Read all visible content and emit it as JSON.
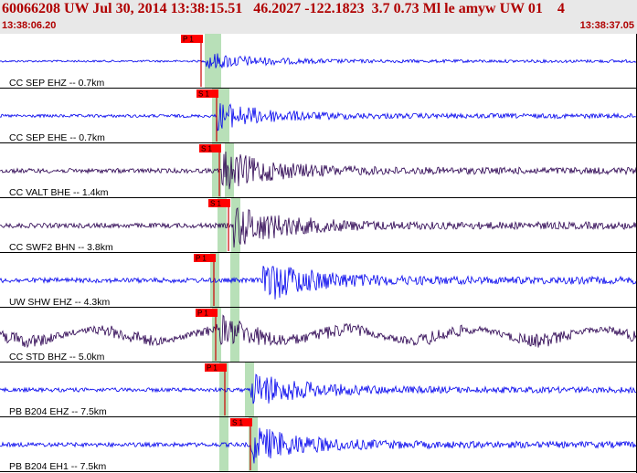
{
  "header": {
    "title": "60066208 UW Jul 30, 2014 13:38:15.51   46.2027 -122.1823  3.7 0.73 Ml le amyw UW 01    4",
    "start_time": "13:38:06.20",
    "end_time": "13:38:37.05"
  },
  "colors": {
    "header_text": "#b00000",
    "header_bg": "#e8e8e8",
    "pick_box": "#ff0000",
    "pick_line": "#cc0000",
    "window_band": "#b8e0b8",
    "trace_blue": "#0000ee",
    "trace_purple": "#2a0050"
  },
  "traces": [
    {
      "label": "CC SEP EHZ -- 0.7km",
      "color": "blue",
      "pick": "P 1",
      "amplitude": 0.35
    },
    {
      "label": "CC SEP EHE -- 0.7km",
      "color": "blue",
      "pick": "S 1",
      "amplitude": 0.55
    },
    {
      "label": "CC VALT BHE -- 1.4km",
      "color": "purple",
      "pick": "S 1",
      "amplitude": 0.8
    },
    {
      "label": "CC SWF2 BHN -- 3.8km",
      "color": "purple",
      "pick": "S 1",
      "amplitude": 0.85
    },
    {
      "label": "UW SHW EHZ -- 4.3km",
      "color": "blue",
      "pick": "P 1",
      "amplitude": 0.85
    },
    {
      "label": "CC STD BHZ -- 5.0km",
      "color": "purple",
      "pick": "P 1",
      "amplitude": 0.6
    },
    {
      "label": "PB B204 EHZ -- 7.5km",
      "color": "blue",
      "pick": "P 1",
      "amplitude": 0.7
    },
    {
      "label": "PB B204 EH1 -- 7.5km",
      "color": "blue",
      "pick": "S 1",
      "amplitude": 0.75
    }
  ]
}
